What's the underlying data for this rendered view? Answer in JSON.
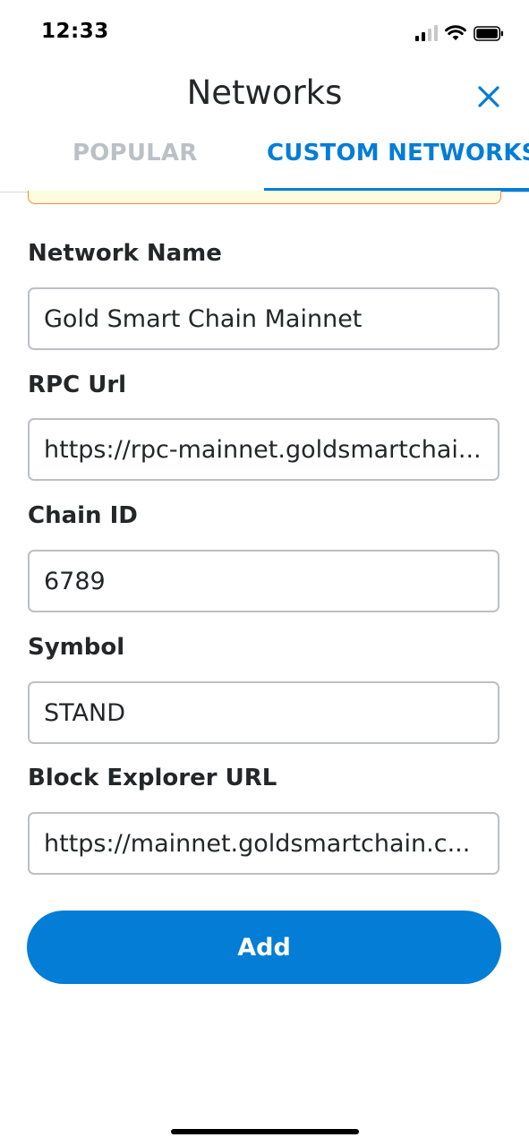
{
  "status_bar": {
    "time": "12:33",
    "signal_icon": "cellular-signal-icon",
    "wifi_icon": "wifi-icon",
    "battery_icon": "battery-icon"
  },
  "header": {
    "title": "Networks",
    "close_icon": "close-icon",
    "accent_color": "#037dd6"
  },
  "tabs": [
    {
      "label": "POPULAR",
      "active": false
    },
    {
      "label": "CUSTOM NETWORKS",
      "active": true
    }
  ],
  "form": {
    "network_name": {
      "label": "Network Name",
      "value": "Gold Smart Chain Mainnet"
    },
    "rpc_url": {
      "label": "RPC Url",
      "value": "https://rpc-mainnet.goldsmartchai..."
    },
    "chain_id": {
      "label": "Chain ID",
      "value": "6789"
    },
    "symbol": {
      "label": "Symbol",
      "value": "STAND"
    },
    "block_explorer_url": {
      "label": "Block Explorer URL",
      "value": "https://mainnet.goldsmartchain.c..."
    }
  },
  "add_button": {
    "label": "Add",
    "color": "#037dd6"
  }
}
